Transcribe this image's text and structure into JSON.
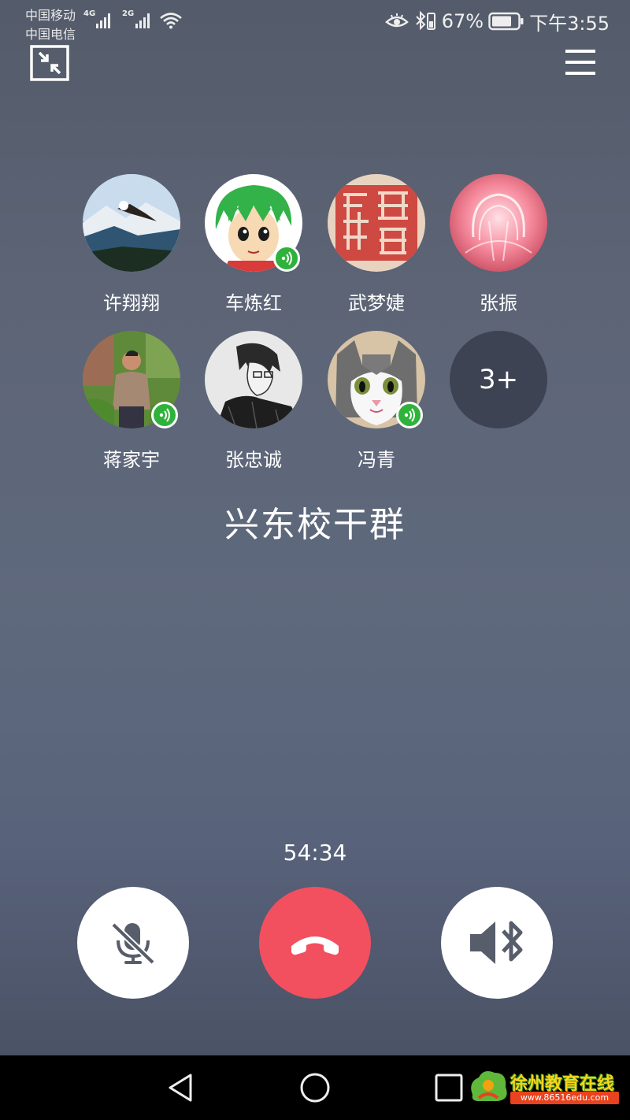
{
  "status_bar": {
    "carrier_1": "中国移动",
    "carrier_2": "中国电信",
    "net_1": "4G",
    "net_2": "2G",
    "battery_percent": "67%",
    "time": "下午3:55"
  },
  "members": [
    {
      "name": "许翔翔",
      "speaking": false,
      "avatar": "eagle-photo"
    },
    {
      "name": "车炼红",
      "speaking": true,
      "avatar": "anime-green-hair"
    },
    {
      "name": "武梦婕",
      "speaking": false,
      "avatar": "red-seal-stamp"
    },
    {
      "name": "张振",
      "speaking": false,
      "avatar": "pink-glow"
    },
    {
      "name": "蒋家宇",
      "speaking": true,
      "avatar": "man-outdoors-photo"
    },
    {
      "name": "张忠诚",
      "speaking": false,
      "avatar": "sketch-man"
    },
    {
      "name": "冯青",
      "speaking": true,
      "avatar": "cat-face-photo"
    }
  ],
  "more_count": "3+",
  "group_name": "兴东校干群",
  "call_duration": "54:34",
  "controls": {
    "mute_icon": "mic-off-icon",
    "hangup_icon": "phone-hangup-icon",
    "speaker_icon": "bluetooth-speaker-icon",
    "hangup_color": "#f2505f"
  },
  "watermark": {
    "title": "徐州教育在线",
    "url": "www.86516edu.com"
  }
}
